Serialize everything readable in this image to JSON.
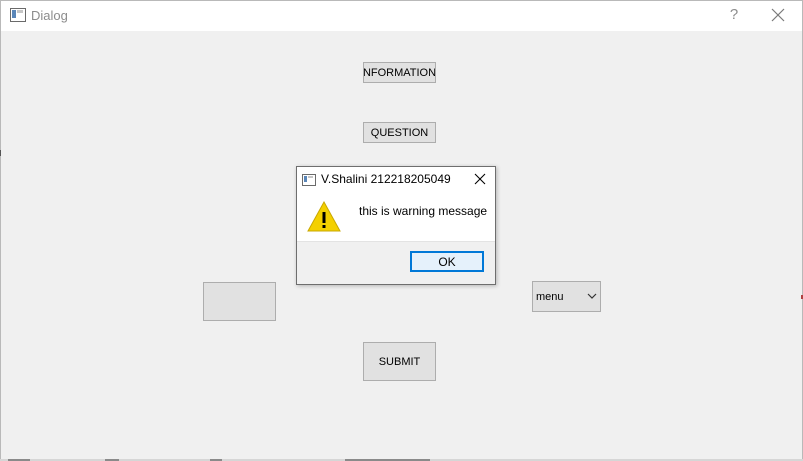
{
  "window": {
    "title": "Dialog",
    "help_glyph": "?"
  },
  "buttons": {
    "information_label": "NFORMATION",
    "question_label": "QUESTION",
    "blank_label": "",
    "submit_label": "SUBMIT"
  },
  "combo": {
    "selected": "menu"
  },
  "message_box": {
    "title": "V.Shalini 212218205049",
    "text": "this is warning message",
    "ok_label": "OK",
    "icon": "warning-icon"
  },
  "colors": {
    "ok_border": "#0078d7",
    "warning_fill": "#f4d000"
  }
}
